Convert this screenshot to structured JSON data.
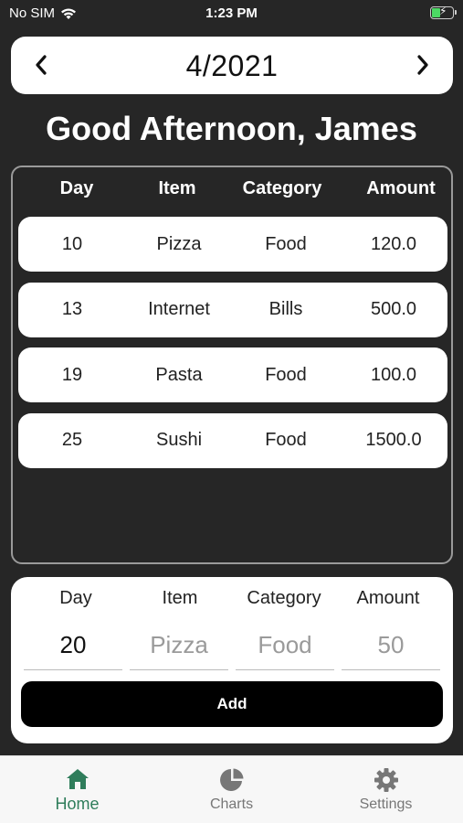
{
  "status": {
    "carrier": "No SIM",
    "time": "1:23 PM"
  },
  "month": {
    "label": "4/2021"
  },
  "greeting": "Good Afternoon, James",
  "table": {
    "headers": {
      "day": "Day",
      "item": "Item",
      "category": "Category",
      "amount": "Amount"
    },
    "rows": [
      {
        "day": "10",
        "item": "Pizza",
        "category": "Food",
        "amount": "120.0"
      },
      {
        "day": "13",
        "item": "Internet",
        "category": "Bills",
        "amount": "500.0"
      },
      {
        "day": "19",
        "item": "Pasta",
        "category": "Food",
        "amount": "100.0"
      },
      {
        "day": "25",
        "item": "Sushi",
        "category": "Food",
        "amount": "1500.0"
      }
    ]
  },
  "form": {
    "labels": {
      "day": "Day",
      "item": "Item",
      "category": "Category",
      "amount": "Amount"
    },
    "day_value": "20",
    "item_placeholder": "Pizza",
    "category_placeholder": "Food",
    "amount_placeholder": "50",
    "add_label": "Add"
  },
  "nav": {
    "items": [
      {
        "label": "Home",
        "icon": "home-icon",
        "active": true
      },
      {
        "label": "Charts",
        "icon": "pie-chart-icon",
        "active": false
      },
      {
        "label": "Settings",
        "icon": "gear-icon",
        "active": false
      }
    ]
  },
  "colors": {
    "accent": "#2f7d5b",
    "background": "#262626"
  }
}
